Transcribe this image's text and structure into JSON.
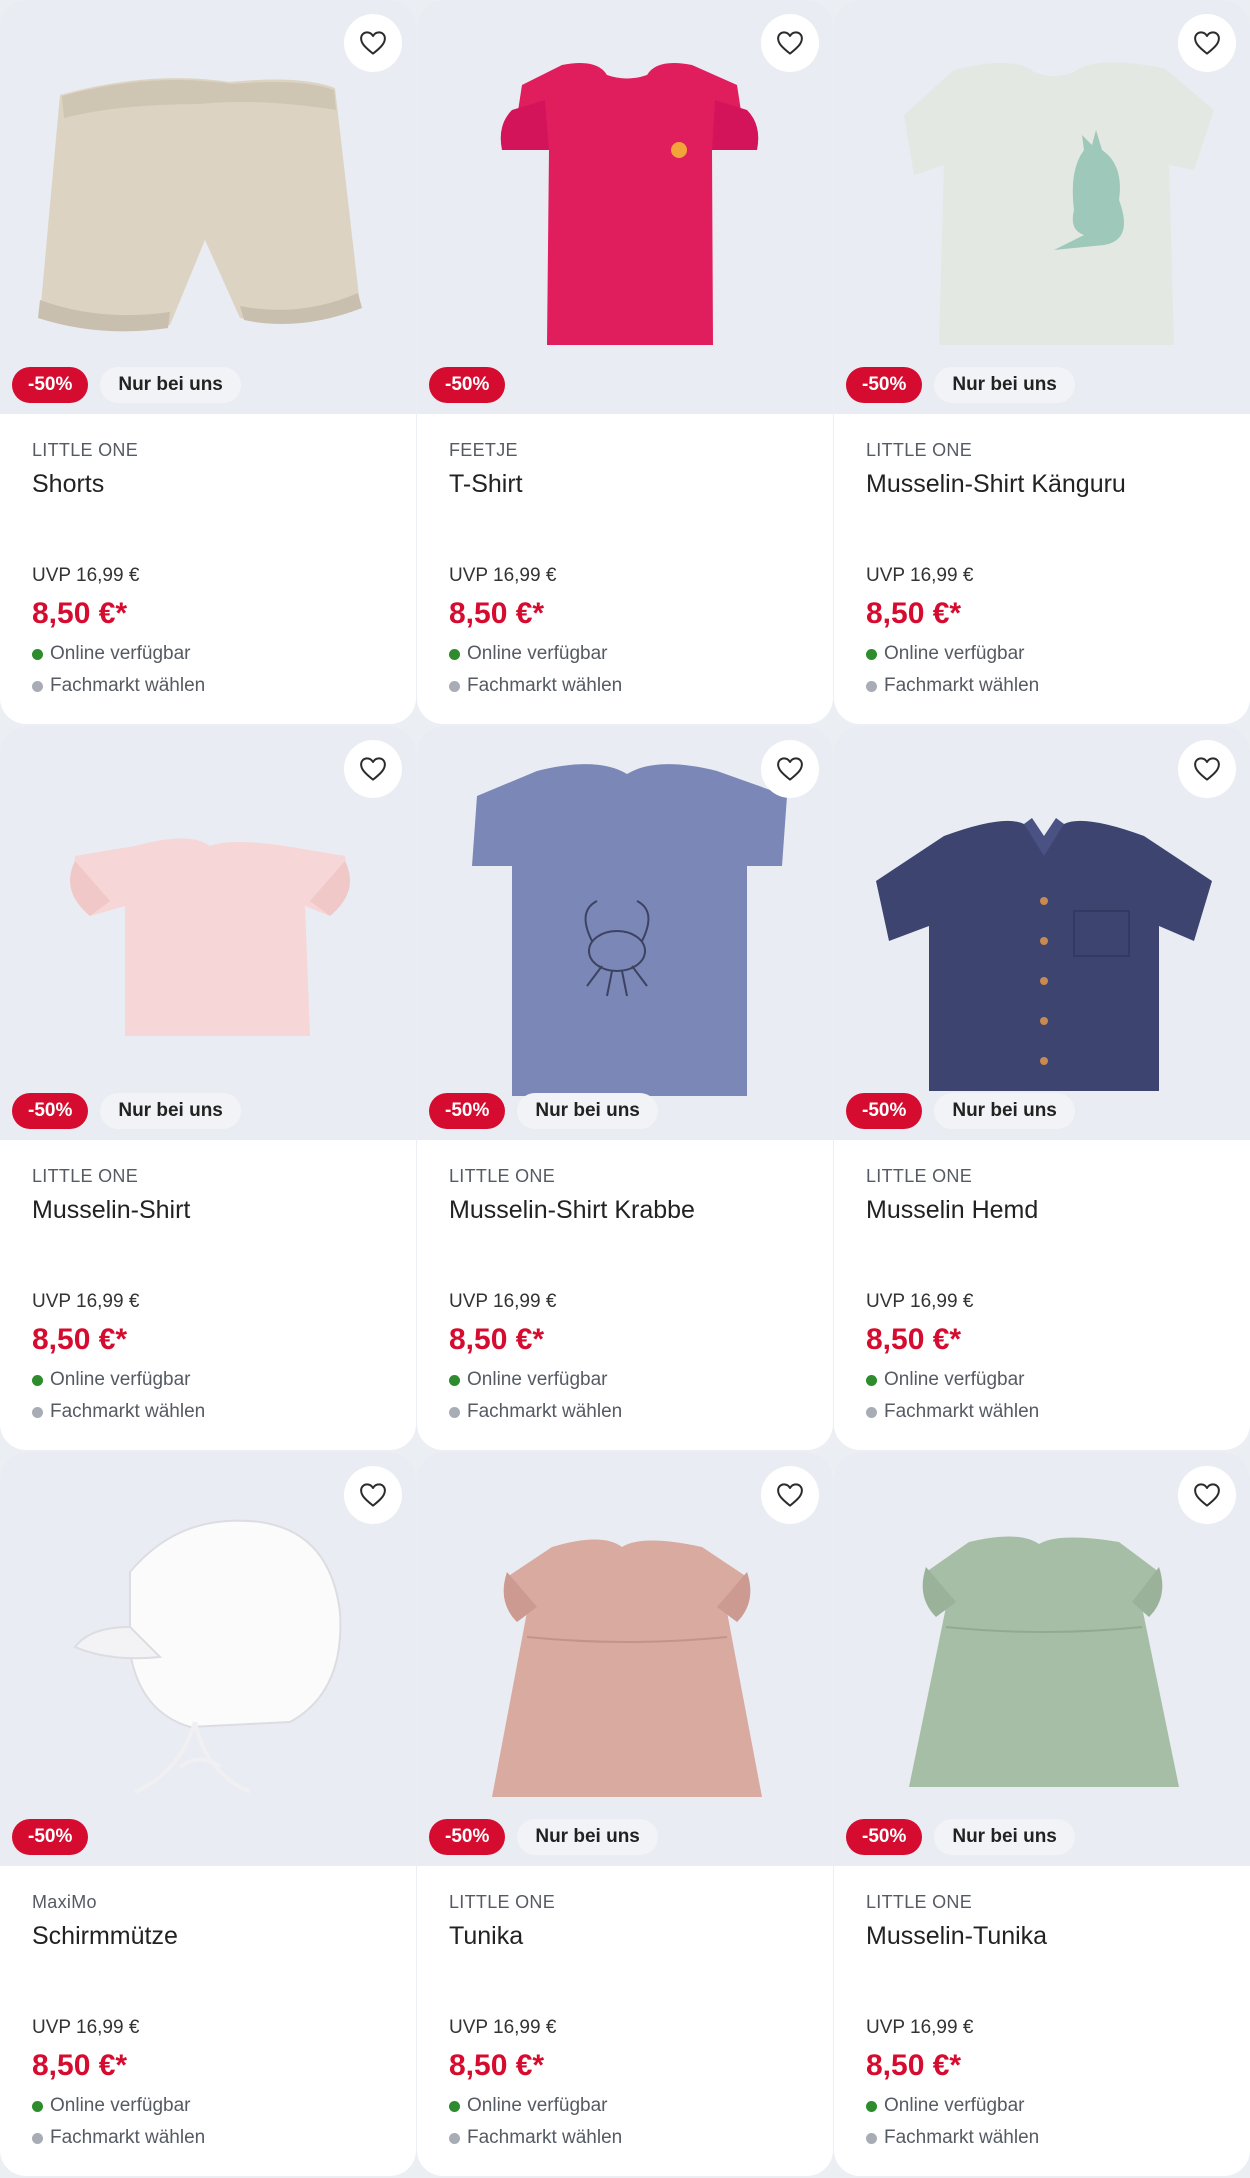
{
  "colors": {
    "sale": "#d50c2f",
    "online_dot": "#2e8b2e",
    "store_dot": "#a8adb5",
    "background": "#ebeef3"
  },
  "products": [
    {
      "brand": "LITTLE ONE",
      "title": "Shorts",
      "uvp": "UVP 16,99 €",
      "price": "8,50 €*",
      "sale_badge": "-50%",
      "exclusive_badge": "Nur bei uns",
      "online": "Online verfügbar",
      "store": "Fachmarkt wählen",
      "image": "beige-shorts"
    },
    {
      "brand": "FEETJE",
      "title": "T-Shirt",
      "uvp": "UVP 16,99 €",
      "price": "8,50 €*",
      "sale_badge": "-50%",
      "exclusive_badge": "",
      "online": "Online verfügbar",
      "store": "Fachmarkt wählen",
      "image": "pink-tshirt"
    },
    {
      "brand": "LITTLE ONE",
      "title": "Musselin-Shirt Känguru",
      "uvp": "UVP 16,99 €",
      "price": "8,50 €*",
      "sale_badge": "-50%",
      "exclusive_badge": "Nur bei uns",
      "online": "Online verfügbar",
      "store": "Fachmarkt wählen",
      "image": "kangaroo-shirt"
    },
    {
      "brand": "LITTLE ONE",
      "title": "Musselin-Shirt",
      "uvp": "UVP 16,99 €",
      "price": "8,50 €*",
      "sale_badge": "-50%",
      "exclusive_badge": "Nur bei uns",
      "online": "Online verfügbar",
      "store": "Fachmarkt wählen",
      "image": "light-pink-shirt"
    },
    {
      "brand": "LITTLE ONE",
      "title": "Musselin-Shirt Krabbe",
      "uvp": "UVP 16,99 €",
      "price": "8,50 €*",
      "sale_badge": "-50%",
      "exclusive_badge": "Nur bei uns",
      "online": "Online verfügbar",
      "store": "Fachmarkt wählen",
      "image": "crab-shirt"
    },
    {
      "brand": "LITTLE ONE",
      "title": "Musselin Hemd",
      "uvp": "UVP 16,99 €",
      "price": "8,50 €*",
      "sale_badge": "-50%",
      "exclusive_badge": "Nur bei uns",
      "online": "Online verfügbar",
      "store": "Fachmarkt wählen",
      "image": "navy-shirt"
    },
    {
      "brand": "MaxiMo",
      "title": "Schirmmütze",
      "uvp": "UVP 16,99 €",
      "price": "8,50 €*",
      "sale_badge": "-50%",
      "exclusive_badge": "",
      "online": "Online verfügbar",
      "store": "Fachmarkt wählen",
      "image": "white-cap"
    },
    {
      "brand": "LITTLE ONE",
      "title": "Tunika",
      "uvp": "UVP 16,99 €",
      "price": "8,50 €*",
      "sale_badge": "-50%",
      "exclusive_badge": "Nur bei uns",
      "online": "Online verfügbar",
      "store": "Fachmarkt wählen",
      "image": "rose-tunic"
    },
    {
      "brand": "LITTLE ONE",
      "title": "Musselin-Tunika",
      "uvp": "UVP 16,99 €",
      "price": "8,50 €*",
      "sale_badge": "-50%",
      "exclusive_badge": "Nur bei uns",
      "online": "Online verfügbar",
      "store": "Fachmarkt wählen",
      "image": "sage-tunic"
    }
  ]
}
